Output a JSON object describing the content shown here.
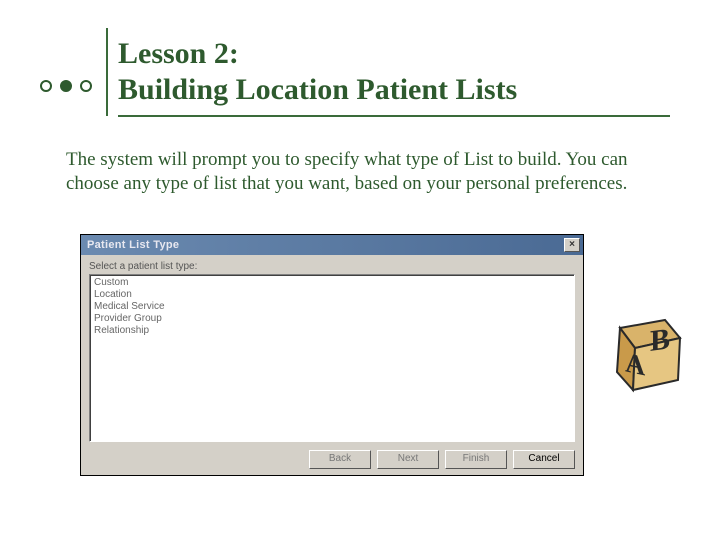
{
  "header": {
    "title_line1": "Lesson 2:",
    "title_line2": "Building Location Patient Lists"
  },
  "body": {
    "paragraph": "The system will prompt you to specify what type of List to build. You can choose any type of list that you want, based on your personal preferences."
  },
  "dialog": {
    "title": "Patient List Type",
    "close_label": "×",
    "select_label": "Select a patient list type:",
    "list_items": {
      "0": "Custom",
      "1": "Location",
      "2": "Medical Service",
      "3": "Provider Group",
      "4": "Relationship"
    },
    "buttons": {
      "back": "Back",
      "next": "Next",
      "finish": "Finish",
      "cancel": "Cancel"
    }
  },
  "decor": {
    "letter_a": "A",
    "letter_b": "B"
  }
}
